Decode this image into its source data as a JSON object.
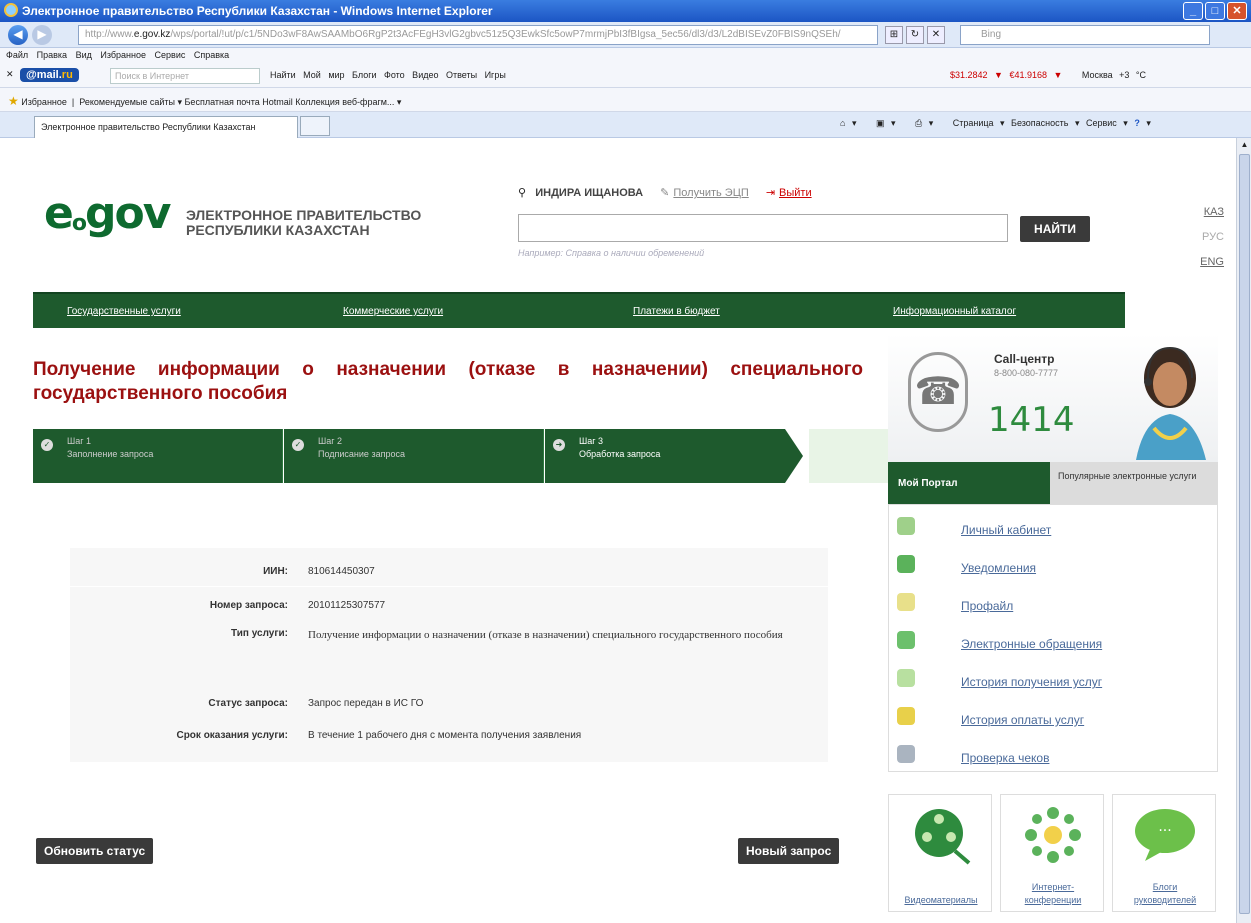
{
  "window": {
    "title": "Электронное правительство Республики Казахстан - Windows Internet Explorer"
  },
  "addressbar": {
    "url_prefix": "http://www.",
    "url_host": "e.gov.kz",
    "url_rest": "/wps/portal/!ut/p/c1/5NDo3wF8AwSAAMbO6RgP2t3AcFEgH3vlG2gbvc51z5Q3EwkSfc5owP7mrmjPbI3fBIgsa_5ec56/dl3/d3/L2dBISEvZ0FBIS9nQSEh/",
    "bing_placeholder": "Bing"
  },
  "menubar": {
    "items": [
      "Файл",
      "Правка",
      "Вид",
      "Избранное",
      "Сервис",
      "Справка"
    ]
  },
  "mailbar": {
    "brand_a": "@mail.",
    "brand_b": "ru",
    "search_placeholder": "Поиск в Интернет",
    "tools": "Найти  Мой мир  Блоги  Фото  Видео  Ответы  Игры",
    "currency": "$31.2842 ▼  €41.9168 ▼",
    "weather": "Москва +3 °C"
  },
  "favbar": {
    "label": "Избранное",
    "items": "Рекомендуемые сайты ▾   Бесплатная почта Hotmail   Коллекция веб-фрагм... ▾"
  },
  "tabbar": {
    "tab": "Электронное правительство Республики Казахстан",
    "commands": "Страница ▾  Безопасность ▾  Сервис ▾"
  },
  "header": {
    "logo_e": "e",
    "logo_sub": "o",
    "logo_gov": "gov",
    "logo_line1": "ЭЛЕКТРОННОЕ ПРАВИТЕЛЬСТВО",
    "logo_line2": "РЕСПУБЛИКИ КАЗАХСТАН",
    "user_name": "ИНДИРА ИЩАНОВА",
    "get_eds": "Получить ЭЦП",
    "logout": "Выйти",
    "search_hint": "Например: Справка о наличии обременений",
    "find_button": "НАЙТИ",
    "langs": [
      "КАЗ",
      "РУС",
      "ENG"
    ]
  },
  "nav": {
    "items": [
      "Государственные услуги",
      "Коммерческие услуги",
      "Платежи в бюджет",
      "Информационный каталог"
    ]
  },
  "main": {
    "title": "Получение информации о назначении (отказе в назначении) специального государственного пособия",
    "steps": [
      {
        "name": "Шаг 1",
        "desc": "Заполнение запроса"
      },
      {
        "name": "Шаг 2",
        "desc": "Подписание запроса"
      },
      {
        "name": "Шаг 3",
        "desc": "Обработка запроса"
      }
    ],
    "info": [
      {
        "label": "ИИН:",
        "value": "810614450307"
      },
      {
        "label": "Номер запроса:",
        "value": "20101125307577"
      },
      {
        "label": "Тип услуги:",
        "value": "Получение информации о назначении (отказе в назначении) специального государственного пособия"
      },
      {
        "label": "Статус запроса:",
        "value": "Запрос передан в ИС ГО"
      },
      {
        "label": "Срок оказания услуги:",
        "value": "В течение 1 рабочего дня с момента получения заявления"
      }
    ],
    "refresh_button": "Обновить статус",
    "new_request_button": "Новый запрос"
  },
  "sidebar": {
    "call_title": "Call-центр",
    "call_phone": "8-800-080-7777",
    "call_short": "1414",
    "tab_portal": "Мой Портал",
    "tab_popular": "Популярные электронные услуги",
    "links": [
      "Личный кабинет",
      "Уведомления",
      "Профайл",
      "Электронные обращения",
      "История получения услуг",
      "История оплаты услуг",
      "Проверка чеков"
    ],
    "tiles": [
      "Видеоматериалы",
      "Интернет-конференции",
      "Блоги руководителей"
    ]
  },
  "colors": {
    "gov_green": "#1e5a2d",
    "title_red": "#9b1010"
  }
}
